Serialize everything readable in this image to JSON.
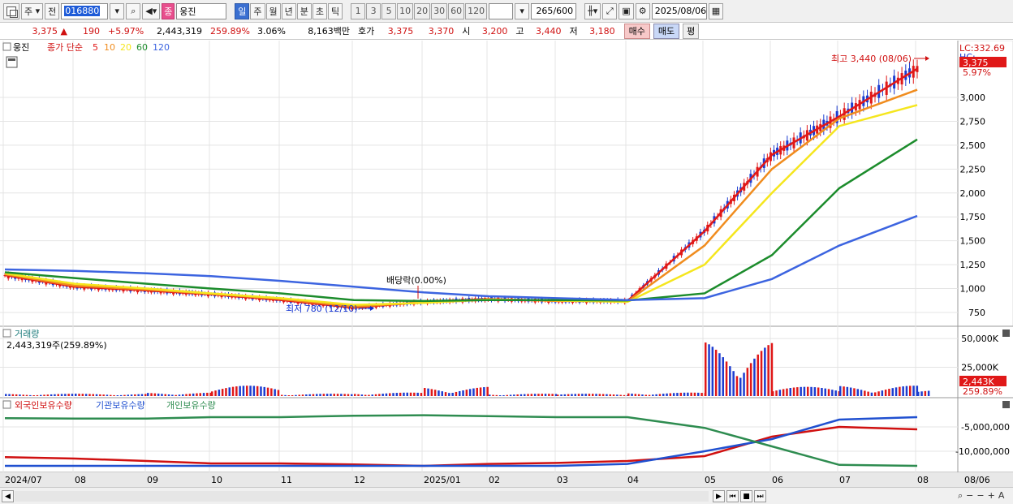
{
  "toolbar": {
    "type_label": "주",
    "range_label": "전",
    "code": "016880",
    "name": "웅진",
    "badge": "종",
    "periods": [
      "일",
      "주",
      "월",
      "년",
      "분",
      "초",
      "틱"
    ],
    "active_period": "일",
    "intervals": [
      "1",
      "3",
      "5",
      "10",
      "20",
      "30",
      "60",
      "120"
    ],
    "count": "265",
    "count_max": "/600",
    "date": "2025/08/06"
  },
  "quote": {
    "price": "3,375 ▲",
    "change": "190",
    "change_pct": "+5.97%",
    "volume": "2,443,319",
    "volume_ratio": "259.89%",
    "turnover": "3.06%",
    "amount": "8,163백만",
    "bid_label": "호가",
    "ask": "3,375",
    "bid": "3,370",
    "open_label": "시",
    "open": "3,200",
    "high_label": "고",
    "high": "3,440",
    "low_label": "저",
    "low": "3,180",
    "buy_label": "매수",
    "sell_label": "매도",
    "eval_label": "평"
  },
  "price_panel": {
    "name": "웅진",
    "legend_title": "종가 단순",
    "ma": [
      {
        "label": "5",
        "color": "#e01818"
      },
      {
        "label": "10",
        "color": "#f08c1e"
      },
      {
        "label": "20",
        "color": "#f5e61e"
      },
      {
        "label": "60",
        "color": "#1c8c2c"
      },
      {
        "label": "120",
        "color": "#3c64e0"
      }
    ],
    "lc_label": "LC:332.69",
    "hc_label": "HC:",
    "last_price_tag": "3,375",
    "last_pct_tag": "5.97%",
    "y_ticks": [
      "3,000",
      "2,750",
      "2,500",
      "2,250",
      "2,000",
      "1,750",
      "1,500",
      "1,250",
      "1,000",
      "750"
    ],
    "high_annotation": "최고 3,440 (08/06)",
    "low_annotation": "최저 780 (12/10)",
    "dividend_annotation": "배당락(0.00%)"
  },
  "volume_panel": {
    "title": "거래량",
    "value": "2,443,319주(259.89%)",
    "y_ticks": [
      "50,000K",
      "25,000K"
    ],
    "last_tag": "2,443K",
    "last_pct_tag": "259.89%"
  },
  "holdings_panel": {
    "legend": [
      {
        "label": "외국인보유수량",
        "color": "#d01010"
      },
      {
        "label": "기관보유수량",
        "color": "#2050d0"
      },
      {
        "label": "개인보유수량",
        "color": "#2e8c50"
      }
    ],
    "y_ticks": [
      "-5,000,000",
      "-10,000,000"
    ]
  },
  "x_axis": {
    "labels": [
      "2024/07",
      "08",
      "09",
      "10",
      "11",
      "12",
      "2025/01",
      "02",
      "03",
      "04",
      "05",
      "06",
      "07",
      "08"
    ],
    "end_date": "08/06"
  },
  "colors": {
    "candle_up": "#e01818",
    "candle_down": "#1c3cd0",
    "grid": "#e4e4e4"
  },
  "chart_data": {
    "type": "line",
    "title": "",
    "x": [
      "2024/07",
      "08",
      "09",
      "10",
      "11",
      "12",
      "2025/01",
      "02",
      "03",
      "04",
      "05",
      "06",
      "07",
      "08"
    ],
    "ylim": [
      650,
      3500
    ],
    "series": [
      {
        "name": "5",
        "values": [
          1140,
          1020,
          980,
          940,
          880,
          800,
          860,
          890,
          870,
          870,
          1600,
          2400,
          2800,
          3300
        ]
      },
      {
        "name": "10",
        "values": [
          1150,
          1030,
          990,
          945,
          890,
          810,
          855,
          888,
          872,
          865,
          1450,
          2250,
          2780,
          3080
        ]
      },
      {
        "name": "20",
        "values": [
          1160,
          1050,
          1000,
          950,
          900,
          830,
          850,
          885,
          875,
          860,
          1250,
          2000,
          2700,
          2920
        ]
      },
      {
        "name": "60",
        "values": [
          1170,
          1110,
          1050,
          1000,
          950,
          880,
          870,
          880,
          880,
          875,
          950,
          1350,
          2050,
          2560
        ]
      },
      {
        "name": "120",
        "values": [
          1200,
          1185,
          1160,
          1130,
          1080,
          1020,
          960,
          920,
          900,
          880,
          900,
          1100,
          1450,
          1760
        ]
      }
    ],
    "volume": [
      2,
      2,
      3,
      9,
      2,
      3,
      8,
      2,
      2,
      3,
      48,
      8,
      9,
      5
    ],
    "holdings": [
      {
        "name": "외국인보유수량",
        "values": [
          -11200000,
          -11500000,
          -12000000,
          -12500000,
          -12500000,
          -12700000,
          -13000000,
          -12600000,
          -12400000,
          -12000000,
          -11000000,
          -7000000,
          -5000000,
          -5500000
        ]
      },
      {
        "name": "기관보유수량",
        "values": [
          -13000000,
          -13000000,
          -13000000,
          -13000000,
          -13000000,
          -13000000,
          -13000000,
          -13000000,
          -13000000,
          -12600000,
          -10000000,
          -7500000,
          -3500000,
          -3000000
        ]
      },
      {
        "name": "개인보유수량",
        "values": [
          -3200000,
          -3300000,
          -3300000,
          -3000000,
          -3000000,
          -2700000,
          -2600000,
          -2800000,
          -3000000,
          -3000000,
          -5200000,
          -9000000,
          -12800000,
          -13000000
        ]
      }
    ]
  }
}
